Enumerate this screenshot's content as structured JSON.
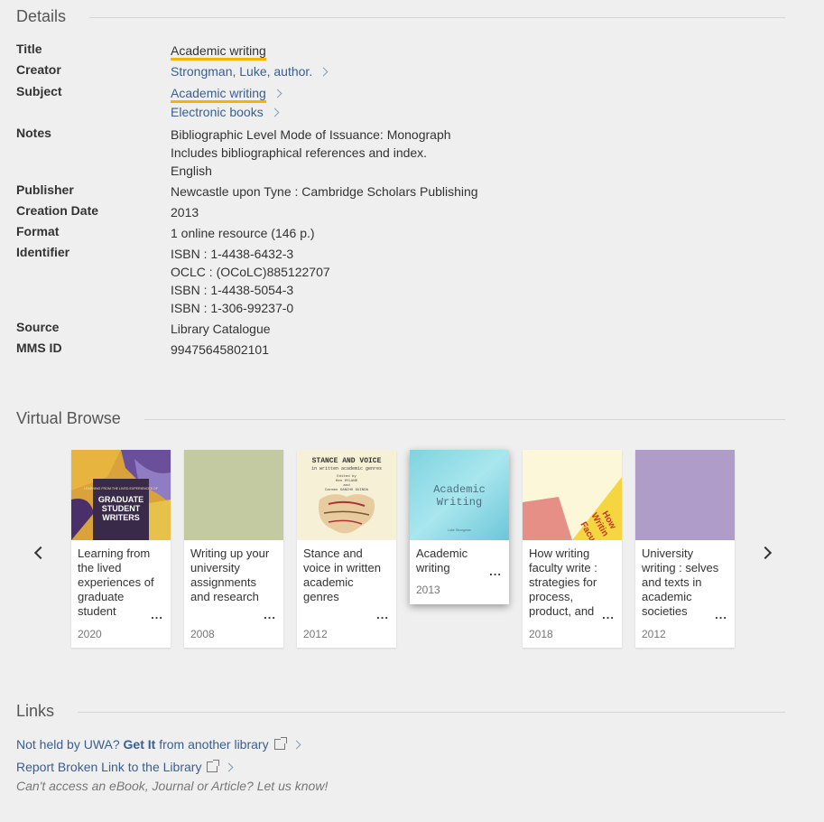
{
  "details": {
    "heading": "Details",
    "rows": [
      {
        "label": "Title",
        "values": [
          "Academic writing"
        ]
      },
      {
        "label": "Creator",
        "values": [
          "Strongman, Luke, author."
        ]
      },
      {
        "label": "Subject",
        "values": [
          "Academic writing",
          "Electronic books"
        ]
      },
      {
        "label": "Notes",
        "values": [
          "Bibliographic Level Mode of Issuance: Monograph",
          "Includes bibliographical references and index.",
          "English"
        ]
      },
      {
        "label": "Publisher",
        "values": [
          "Newcastle upon Tyne : Cambridge Scholars Publishing"
        ]
      },
      {
        "label": "Creation Date",
        "values": [
          "2013"
        ]
      },
      {
        "label": "Format",
        "values": [
          "1 online resource (146 p.)"
        ]
      },
      {
        "label": "Identifier",
        "values": [
          "ISBN : 1-4438-6432-3",
          "OCLC : (OCoLC)885122707",
          "ISBN : 1-4438-5054-3",
          "ISBN : 1-306-99237-0"
        ]
      },
      {
        "label": "Source",
        "values": [
          "Library Catalogue"
        ]
      },
      {
        "label": "MMS ID",
        "values": [
          "99475645802101"
        ]
      }
    ]
  },
  "virtual_browse": {
    "heading": "Virtual Browse",
    "items": [
      {
        "title": "Learning from the lived experiences of graduate student",
        "dots": "...",
        "year": "2020",
        "cover_text": [
          "LEARNING FROM THE LIVED EXPERIENCES OF",
          "GRADUATE",
          "STUDENT",
          "WRITERS"
        ]
      },
      {
        "title": "Writing up your university assignments and research",
        "dots": "...",
        "year": "2008",
        "cover_color": "#c3c9a0"
      },
      {
        "title": "Stance and voice in written academic genres",
        "dots": "...",
        "year": "2012",
        "cover_text": [
          "STANCE AND VOICE",
          "in written academic genres",
          "Edited by",
          "Ken HYLAND",
          "and",
          "Carmen SANCHO GUINDA"
        ]
      },
      {
        "title": "Academic writing",
        "dots": "...",
        "year": "2013",
        "cover_text": [
          "Academic",
          "Writing",
          "Luke Strongman"
        ]
      },
      {
        "title": "How writing faculty write : strategies for process, product, and",
        "dots": "...",
        "year": "2018",
        "cover_text": [
          "How",
          "Writin",
          "Facu"
        ]
      },
      {
        "title": "University writing : selves and texts in academic societies",
        "dots": "...",
        "year": "2012",
        "cover_color": "#b09cc9"
      }
    ]
  },
  "links": {
    "heading": "Links",
    "get_it": {
      "prefix": "Not held by UWA? ",
      "bold": "Get It",
      "suffix": " from another library"
    },
    "report": "Report Broken Link to the Library",
    "note": "Can't access an eBook, Journal or Article? Let us know!"
  },
  "colors": {
    "link": "#3a5f8f",
    "highlight": "#f4b400",
    "background": "#efefef"
  }
}
